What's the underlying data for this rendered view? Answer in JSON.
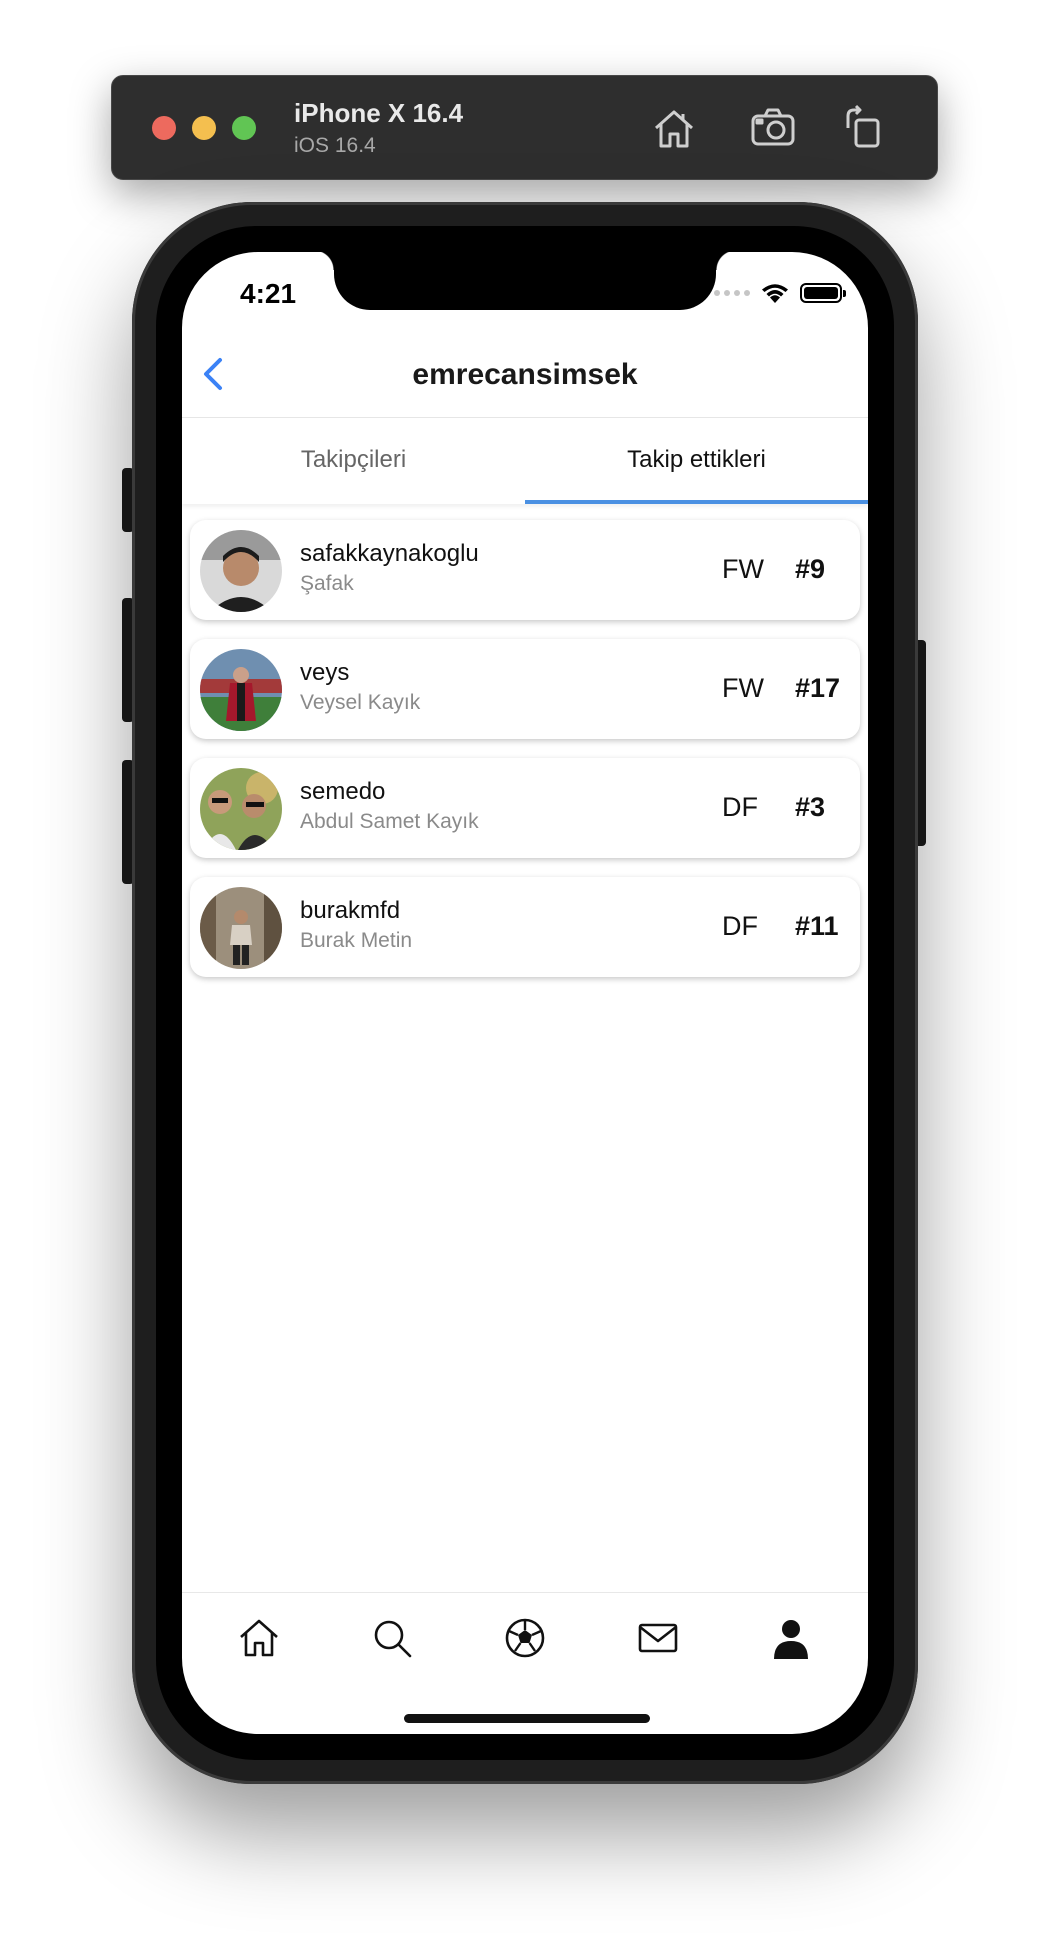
{
  "simulator": {
    "device_title": "iPhone X 16.4",
    "os_version": "iOS 16.4",
    "buttons": [
      "home-icon",
      "screenshot-icon",
      "rotate-icon"
    ]
  },
  "status_bar": {
    "time": "4:21"
  },
  "nav": {
    "title": "emrecansimsek"
  },
  "tabs": [
    {
      "label": "Takipçileri",
      "active": false
    },
    {
      "label": "Takip ettikleri",
      "active": true
    }
  ],
  "users": [
    {
      "username": "safakkaynakoglu",
      "name": "Şafak",
      "position": "FW",
      "number": "#9"
    },
    {
      "username": "veys",
      "name": "Veysel Kayık",
      "position": "FW",
      "number": "#17"
    },
    {
      "username": "semedo",
      "name": "Abdul Samet Kayık",
      "position": "DF",
      "number": "#3"
    },
    {
      "username": "burakmfd",
      "name": "Burak Metin",
      "position": "DF",
      "number": "#11"
    }
  ],
  "tabbar": {
    "items": [
      "home-icon",
      "search-icon",
      "football-icon",
      "mail-icon",
      "profile-icon"
    ],
    "active": "profile-icon"
  },
  "colors": {
    "accent": "#4a90e2",
    "back_chevron": "#3b82f6"
  }
}
